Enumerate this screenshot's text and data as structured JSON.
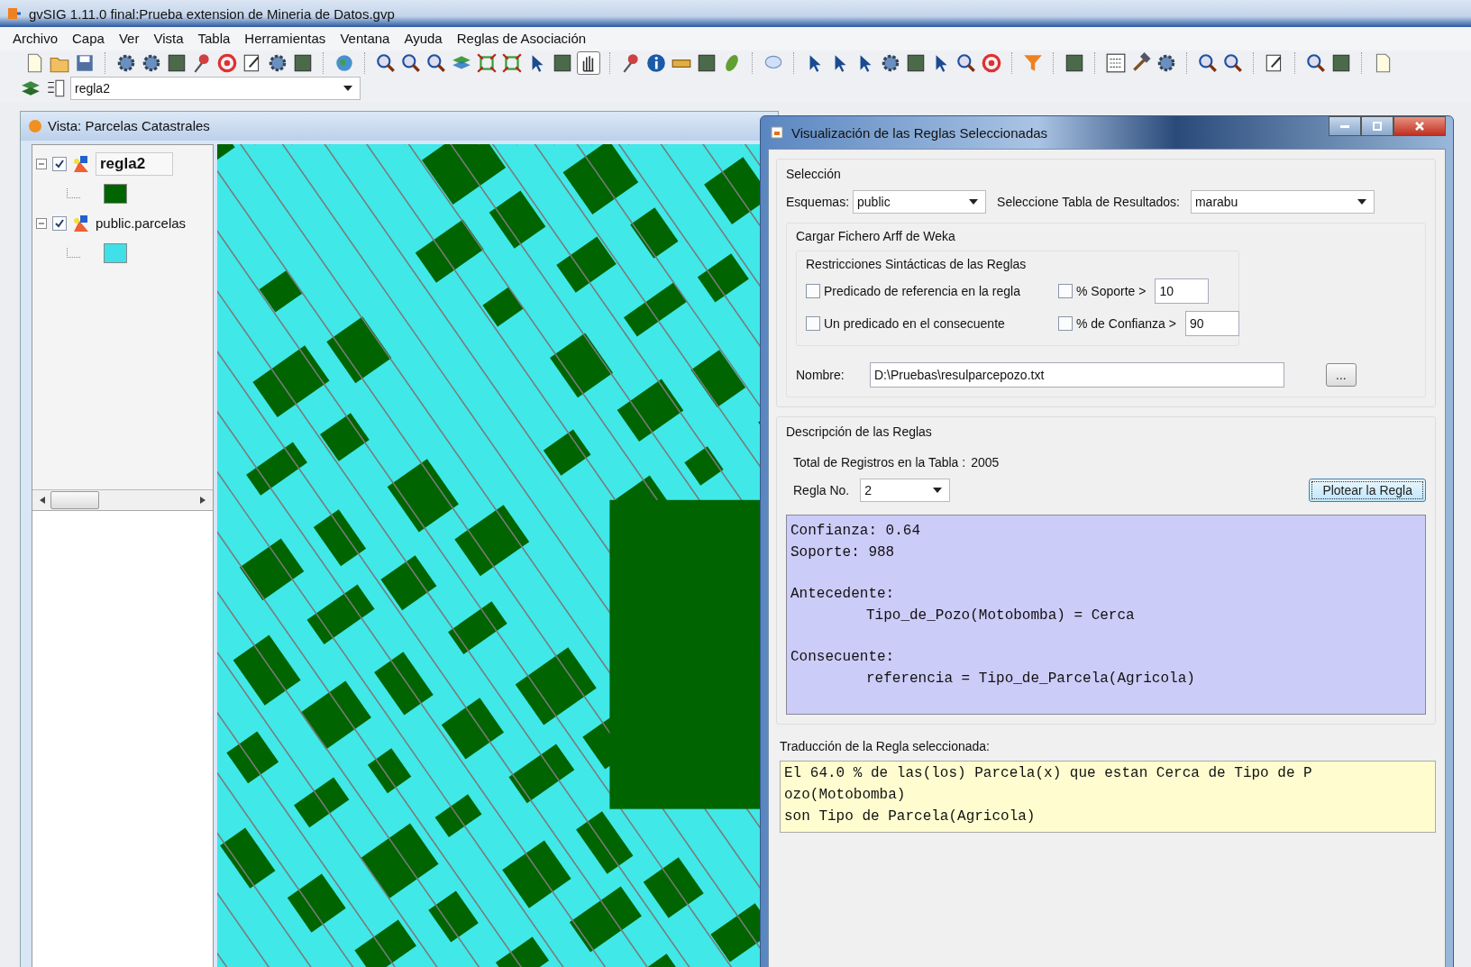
{
  "window": {
    "title": "gvSIG 1.11.0 final:Prueba extension de Mineria de Datos.gvp"
  },
  "menu": [
    "Archivo",
    "Capa",
    "Ver",
    "Vista",
    "Tabla",
    "Herramientas",
    "Ventana",
    "Ayuda",
    "Reglas de Asociación"
  ],
  "layer_selector": {
    "value": "regla2"
  },
  "view": {
    "title": "Vista: Parcelas Catastrales",
    "layers": [
      {
        "name": "regla2",
        "checked": true,
        "selected": true,
        "expanded": true,
        "color": "#006400"
      },
      {
        "name": "public.parcelas",
        "checked": true,
        "selected": false,
        "expanded": true,
        "color": "#40e0e8"
      }
    ]
  },
  "dialog": {
    "title": "Visualización de las Reglas Seleccionadas",
    "seleccion": {
      "legend": "Selección",
      "esquemas_label": "Esquemas:",
      "esquemas_value": "public",
      "tabla_label": "Seleccione Tabla de Resultados:",
      "tabla_value": "marabu"
    },
    "arff": {
      "legend": "Cargar Fichero Arff de Weka",
      "restrictions_legend": "Restricciones Sintácticas de las Reglas",
      "options": [
        {
          "kind": "check",
          "label": "Predicado de referencia en la regla",
          "checked": false
        },
        {
          "kind": "check_value",
          "label": "% Soporte >",
          "checked": false,
          "value": "10"
        },
        {
          "kind": "check",
          "label": "Un predicado en el consecuente",
          "checked": false
        },
        {
          "kind": "check_value",
          "label": "% de Confianza >",
          "checked": false,
          "value": "90"
        }
      ],
      "nombre_label": "Nombre:",
      "nombre_value": "D:\\Pruebas\\resulparcepozo.txt",
      "browse_button": "..."
    },
    "descripcion": {
      "legend": "Descripción de las Reglas",
      "total_label": "Total de Registros en la Tabla :",
      "total_value": "2005",
      "regla_label": "Regla No.",
      "regla_value": "2",
      "plot_button": "Plotear la Regla",
      "rule_groups": [
        {
          "lines": [
            {
              "text": "Confianza: 0.64",
              "indented": false
            },
            {
              "text": "Soporte: 988",
              "indented": false
            }
          ]
        },
        {
          "lines": [
            {
              "text": "Antecedente:",
              "indented": false
            },
            {
              "text": "Tipo_de_Pozo(Motobomba) = Cerca",
              "indented": true
            }
          ]
        },
        {
          "lines": [
            {
              "text": "Consecuente:",
              "indented": false
            },
            {
              "text": "referencia = Tipo_de_Parcela(Agricola)",
              "indented": true
            }
          ]
        }
      ]
    },
    "traduccion": {
      "label": "Traducción de la Regla seleccionada:",
      "lines": [
        "El 64.0 % de las(los) Parcela(x) que estan Cerca de Tipo de P",
        "ozo(Motobomba)",
        "son Tipo de Parcela(Agricola)"
      ]
    }
  }
}
